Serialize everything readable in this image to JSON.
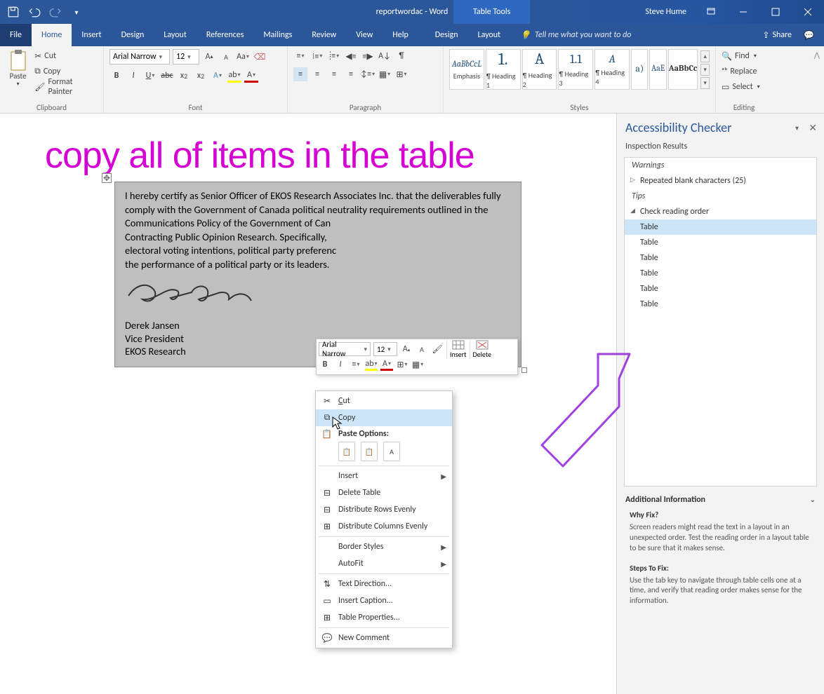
{
  "titlebar": {
    "doc_title": "reportwordac - Word",
    "tool_tab": "Table Tools",
    "user": "Steve Hume"
  },
  "tabs": {
    "file": "File",
    "home": "Home",
    "insert": "Insert",
    "design": "Design",
    "layout": "Layout",
    "references": "References",
    "mailings": "Mailings",
    "review": "Review",
    "view": "View",
    "help": "Help",
    "design2": "Design",
    "layout2": "Layout",
    "tell": "Tell me what you want to do",
    "share": "Share"
  },
  "ribbon": {
    "clipboard": {
      "label": "Clipboard",
      "paste": "Paste",
      "cut": "Cut",
      "copy": "Copy",
      "fmt": "Format Painter"
    },
    "font": {
      "label": "Font",
      "name": "Arial Narrow",
      "size": "12"
    },
    "paragraph": {
      "label": "Paragraph"
    },
    "styles": {
      "label": "Styles",
      "items": [
        {
          "prev": "AaBbCcL",
          "lbl": "Emphasis"
        },
        {
          "prev": "1.",
          "lbl": "¶ Heading 1"
        },
        {
          "prev": "A",
          "lbl": "¶ Heading 2"
        },
        {
          "prev": "1.1",
          "lbl": "¶ Heading 3"
        },
        {
          "prev": "A",
          "lbl": "¶ Heading 4"
        },
        {
          "prev": "a)",
          "lbl": ""
        },
        {
          "prev": "AaE",
          "lbl": ""
        },
        {
          "prev": "AaBbCc",
          "lbl": ""
        }
      ]
    },
    "editing": {
      "label": "Editing",
      "find": "Find",
      "replace": "Replace",
      "select": "Select"
    }
  },
  "instruction": "copy all of items in the table",
  "document": {
    "para": "I hereby certify as Senior Officer of EKOS Research Associates Inc. that the deliverables fully comply with the Government of Canada political neutrality requirements outlined in the Communications Policy of the Government of Can",
    "para2": "Contracting Public Opinion Research. Specifically,",
    "para3": "electoral voting intentions, political party preferenc",
    "para4": "the performance of a political party or its leaders.",
    "name": "Derek Jansen",
    "role": "Vice President",
    "org": "EKOS Research"
  },
  "mini": {
    "font": "Arial Narrow",
    "size": "12",
    "insert": "Insert",
    "delete": "Delete"
  },
  "context_menu": {
    "cut": "Cut",
    "copy": "Copy",
    "paste_hdr": "Paste Options:",
    "insert": "Insert",
    "delete_table": "Delete Table",
    "dist_rows": "Distribute Rows Evenly",
    "dist_cols": "Distribute Columns Evenly",
    "border": "Border Styles",
    "autofit": "AutoFit",
    "text_dir": "Text Direction...",
    "caption": "Insert Caption...",
    "props": "Table Properties...",
    "comment": "New Comment"
  },
  "pane": {
    "title": "Accessibility Checker",
    "subtitle": "Inspection Results",
    "warnings": "Warnings",
    "repeated": "Repeated blank characters (25)",
    "tips": "Tips",
    "check_order": "Check reading order",
    "table": "Table",
    "addl": "Additional Information",
    "why": "Why Fix?",
    "why_body": "Screen readers might read the text in a layout in an unexpected order. Test the reading order in a layout table to be sure that it makes sense.",
    "steps": "Steps To Fix:",
    "steps_body": "Use the tab key to navigate through table cells one at a time, and verify that reading  order makes sense for the information."
  }
}
